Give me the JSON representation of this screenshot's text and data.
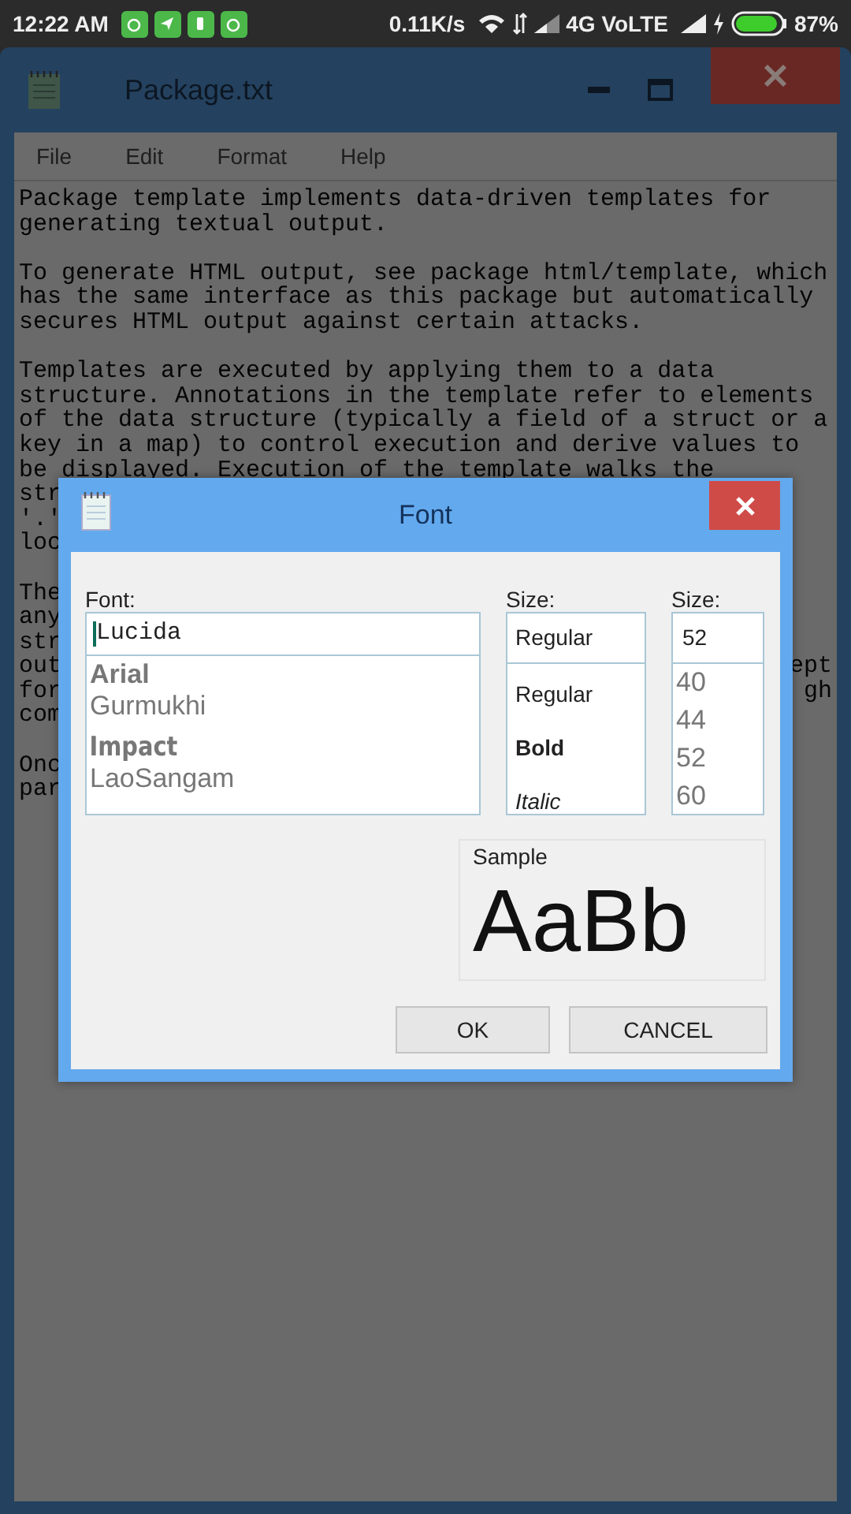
{
  "status_bar": {
    "time": "12:22 AM",
    "speed": "0.11K/s",
    "network": "4G VoLTE",
    "battery": "87%"
  },
  "window": {
    "title": "Package.txt"
  },
  "menu": [
    "File",
    "Edit",
    "Format",
    "Help"
  ],
  "document": {
    "paragraphs": [
      [
        {
          "text": "Package template implements data-driven templates for"
        },
        {
          "text": "generating textual output."
        }
      ],
      [
        {
          "text": "To generate HTML output, see package html/template, which"
        },
        {
          "text": "has the same interface as this package but automatically"
        },
        {
          "text": "secures HTML output against certain attacks."
        }
      ],
      [
        {
          "text": "Templates are executed by applying them to a data"
        },
        {
          "text": "structure. Annotations in the template refer to elements"
        },
        {
          "text": "of the data structure (typically a field of a struct or a"
        },
        {
          "text": "key in a map) to control execution and derive values to"
        },
        {
          "text": "be displayed. Execution of the template walks the"
        },
        {
          "text": "str"
        },
        {
          "text": "'.'"
        },
        {
          "text": "loc"
        }
      ],
      [
        {
          "text": "The"
        },
        {
          "text": "any"
        },
        {
          "text": "str"
        },
        {
          "text": "out",
          "right": "ept"
        },
        {
          "text": "for",
          "right": "gh"
        },
        {
          "text": "com"
        }
      ],
      [
        {
          "text": "Onc"
        },
        {
          "text": "par"
        }
      ]
    ]
  },
  "font_dialog": {
    "title": "Font",
    "font_label": "Font:",
    "font_value": "Lucida",
    "fonts": [
      {
        "name": "Arial",
        "kind": "bold"
      },
      {
        "name": "Gurmukhi",
        "kind": "regular"
      },
      {
        "name": "Impact",
        "kind": "impact"
      },
      {
        "name": "LaoSangam",
        "kind": "regular"
      }
    ],
    "style_label": "Size:",
    "style_value": "Regular",
    "styles": [
      {
        "name": "Regular",
        "kind": "regular"
      },
      {
        "name": "Bold",
        "kind": "bold"
      },
      {
        "name": "Italic",
        "kind": "italic"
      }
    ],
    "size_label": "Size:",
    "size_value": "52",
    "sizes": [
      "40",
      "44",
      "52",
      "60"
    ],
    "sample_label": "Sample",
    "sample_text": "AaBb",
    "buttons": [
      "OK",
      "CANCEL"
    ]
  }
}
